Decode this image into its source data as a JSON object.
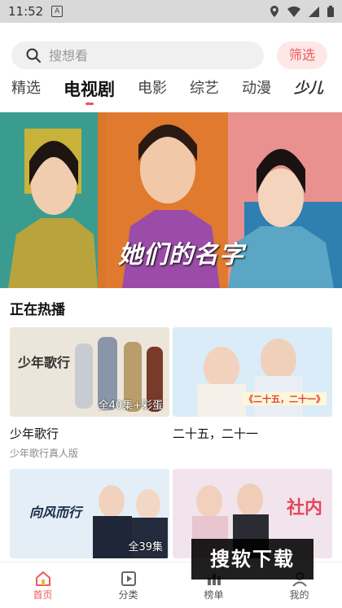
{
  "status": {
    "time": "11:52",
    "sim_icon": "A"
  },
  "search": {
    "placeholder": "搜想看"
  },
  "filter_label": "筛选",
  "tabs": [
    {
      "label": "精选"
    },
    {
      "label": "电视剧",
      "active": true
    },
    {
      "label": "电影"
    },
    {
      "label": "综艺"
    },
    {
      "label": "动漫"
    },
    {
      "label": "少儿"
    }
  ],
  "banner": {
    "show_title": "她们的名字"
  },
  "section": {
    "title": "正在热播"
  },
  "cards": [
    {
      "title": "少年歌行",
      "subtitle": "少年歌行真人版",
      "badge": "全40集+彩蛋",
      "poster_text": "少年歌行"
    },
    {
      "title": "二十五，二十一",
      "subtitle": "",
      "badge": "",
      "poster_text": "《二十五，二十一》"
    },
    {
      "title": "",
      "subtitle": "",
      "badge": "全39集",
      "poster_text": "向风而行"
    },
    {
      "title": "",
      "subtitle": "",
      "badge": "",
      "poster_text": "社内"
    }
  ],
  "bottom_nav": [
    {
      "label": "首页",
      "icon": "home-icon",
      "active": true
    },
    {
      "label": "分类",
      "icon": "category-icon"
    },
    {
      "label": "榜单",
      "icon": "ranking-icon"
    },
    {
      "label": "我的",
      "icon": "profile-icon"
    }
  ],
  "watermark": "搜软下载",
  "colors": {
    "accent": "#f05a5a",
    "filter_bg": "#fde7e7"
  }
}
